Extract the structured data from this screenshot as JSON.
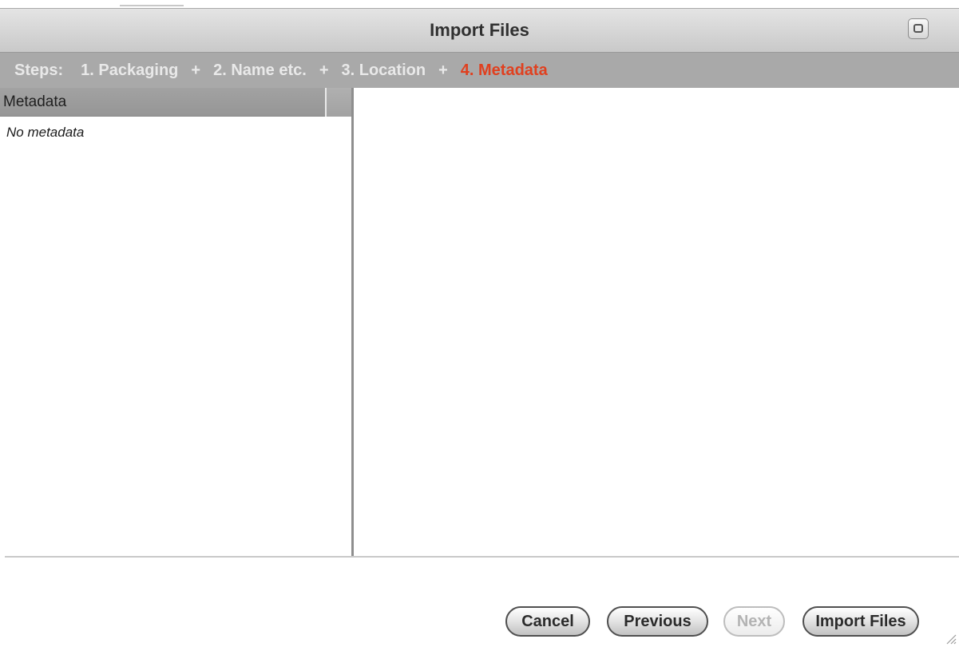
{
  "window": {
    "title": "Import Files"
  },
  "steps": {
    "label": "Steps:",
    "separator": "+",
    "items": [
      {
        "label": "1. Packaging",
        "active": false
      },
      {
        "label": "2. Name etc.",
        "active": false
      },
      {
        "label": "3. Location",
        "active": false
      },
      {
        "label": "4. Metadata",
        "active": true
      }
    ],
    "active_color": "#e0401f"
  },
  "metadata_panel": {
    "column_header": "Metadata",
    "empty_text": "No metadata"
  },
  "buttons": {
    "cancel": "Cancel",
    "previous": "Previous",
    "next": "Next",
    "import": "Import Files"
  },
  "icons": {
    "maximize": "maximize-icon",
    "resize": "resize-grip-icon"
  }
}
